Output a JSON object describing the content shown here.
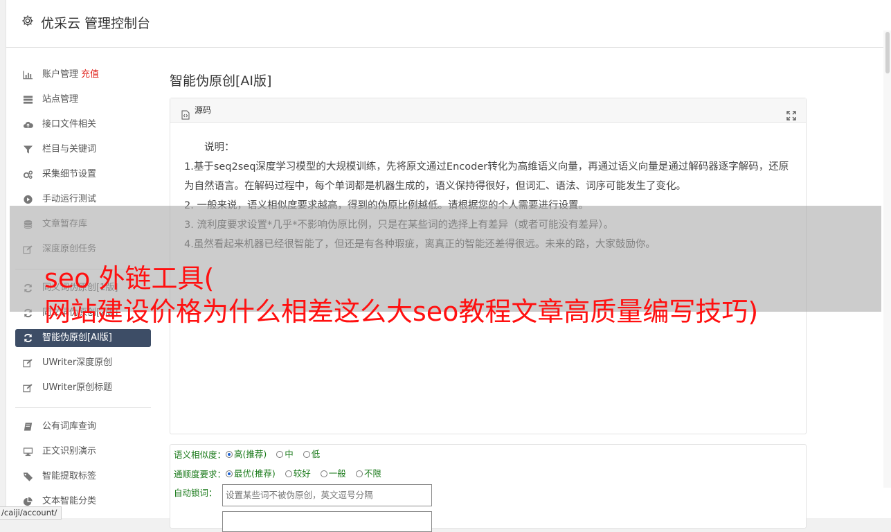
{
  "app": {
    "title": "优采云 管理控制台"
  },
  "sidebar": {
    "groups": [
      [
        {
          "label": "账户管理",
          "badge": "充值",
          "icon": "bar-chart-icon"
        },
        {
          "label": "站点管理",
          "icon": "server-icon"
        },
        {
          "label": "接口文件相关",
          "icon": "cloud-upload-icon"
        },
        {
          "label": "栏目与关键词",
          "icon": "filter-icon"
        },
        {
          "label": "采集细节设置",
          "icon": "gears-icon"
        },
        {
          "label": "手动运行测试",
          "icon": "play-circle-icon"
        },
        {
          "label": "文章暂存库",
          "icon": "database-icon"
        },
        {
          "label": "深度原创任务",
          "icon": "edit-icon"
        }
      ],
      [
        {
          "label": "同义词伪原创[1版]",
          "icon": "refresh-icon"
        },
        {
          "label": "同义词伪原创[2版]",
          "icon": "refresh-icon"
        },
        {
          "label": "智能伪原创[AI版]",
          "icon": "refresh-icon",
          "active": true
        },
        {
          "label": "UWriter深度原创",
          "icon": "edit-icon"
        },
        {
          "label": "UWriter原创标题",
          "icon": "edit-icon"
        }
      ],
      [
        {
          "label": "公有词库查询",
          "icon": "book-icon"
        },
        {
          "label": "正文识别演示",
          "icon": "desktop-icon"
        },
        {
          "label": "智能提取标签",
          "icon": "tag-icon"
        },
        {
          "label": "文本智能分类",
          "icon": "pie-chart-icon"
        }
      ]
    ]
  },
  "main": {
    "page_title": "智能伪原创[AI版]",
    "source_panel": {
      "header_label": "源码",
      "paragraphs": [
        "　　说明：",
        "1.基于seq2seq深度学习模型的大规模训练，先将原文通过Encoder转化为高维语义向量，再通过语义向量是通过解码器逐字解码，还原为自然语言。在解码过程中，每个单词都是机器生成的，语义保持得很好，但词汇、语法、词序可能发生了变化。",
        "2. 一般来说，语义相似度要求越高，得到的伪原比例越低。请根据您的个人需要进行设置。",
        "3. 流利度要求设置*几乎*不影响伪原比例，只是在某些词的选择上有差异（或者可能没有差异）。",
        "4.虽然看起来机器已经很智能了，但还是有各种瑕疵，离真正的智能还差得很远。未来的路，大家鼓励你。"
      ]
    },
    "form": {
      "similarity": {
        "label": "语义相似度：",
        "options": [
          {
            "label": "高(推荐)",
            "checked": true
          },
          {
            "label": "中",
            "checked": false
          },
          {
            "label": "低",
            "checked": false
          }
        ]
      },
      "fluency": {
        "label": "通顺度要求：",
        "options": [
          {
            "label": "最优(推荐)",
            "checked": true
          },
          {
            "label": "较好",
            "checked": false
          },
          {
            "label": "一般",
            "checked": false
          },
          {
            "label": "不限",
            "checked": false
          }
        ]
      },
      "lock_words": {
        "label": "自动锁词：",
        "placeholder": "设置某些词不被伪原创，英文逗号分隔"
      }
    }
  },
  "overlay": {
    "line1": "seo 外链工具(",
    "line2": "网站建设价格为什么相差这么大seo教程文章高质量编写技巧)"
  },
  "status_bar": {
    "url": "/caiji/account/"
  },
  "colors": {
    "active_bg": "#3d4d66",
    "badge": "#e0221b",
    "overlay_text": "#ff1010",
    "form_label": "#1a7a1a"
  }
}
